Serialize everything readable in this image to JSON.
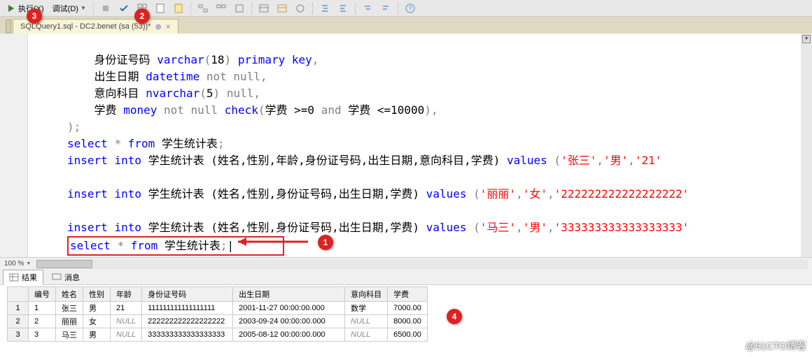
{
  "toolbar": {
    "execute": "执行(X)",
    "debug": "调试(D)"
  },
  "tab": {
    "title": "SQLQuery1.sql - DC2.benet (sa (53))*"
  },
  "code": {
    "line1_col": "身份证号码",
    "line1_type": "varchar",
    "line1_len": "18",
    "line1_pk": "primary key",
    "line2_col": "出生日期",
    "line2_type": "datetime",
    "line2_notnull": "not null",
    "line3_col": "意向科目",
    "line3_type": "nvarchar",
    "line3_len": "5",
    "line3_null": "null",
    "line4_col": "学费",
    "line4_type": "money",
    "line4_notnull": "not null",
    "line4_check": "check",
    "line4_cond_a": "学费 >=0",
    "line4_and": "and",
    "line4_cond_b": "学费 <=10000",
    "closeparen": ");",
    "sel": "select",
    "star": "*",
    "from": "from",
    "tbl": "学生统计表",
    "ins": "insert",
    "into": "into",
    "cols_full": "(姓名,性别,年龄,身份证号码,出生日期,意向科目,学费)",
    "cols_part": "(姓名,性别,身份证号码,出生日期,学费)",
    "values": "values",
    "v1_a": "'张三'",
    "v1_b": "'男'",
    "v1_c": "'21'",
    "v2_a": "'丽丽'",
    "v2_b": "'女'",
    "v2_c": "'222222222222222222'",
    "v3_a": "'马三'",
    "v3_b": "'男'",
    "v3_c": "'333333333333333333'",
    "cursor": "|"
  },
  "zoom": "100 %",
  "results_tabs": {
    "results": "结果",
    "messages": "消息"
  },
  "grid": {
    "headers": [
      "",
      "编号",
      "姓名",
      "性别",
      "年龄",
      "身份证号码",
      "出生日期",
      "意向科目",
      "学费"
    ],
    "rows": [
      {
        "n": "1",
        "id": "1",
        "name": "张三",
        "sex": "男",
        "age": "21",
        "idcard": "111111111111111111",
        "dob": "2001-11-27 00:00:00.000",
        "subj": "数学",
        "fee": "7000.00"
      },
      {
        "n": "2",
        "id": "2",
        "name": "丽丽",
        "sex": "女",
        "age": "NULL",
        "idcard": "222222222222222222",
        "dob": "2003-09-24 00:00:00.000",
        "subj": "NULL",
        "fee": "8000.00"
      },
      {
        "n": "3",
        "id": "3",
        "name": "马三",
        "sex": "男",
        "age": "NULL",
        "idcard": "333333333333333333",
        "dob": "2005-08-12 00:00:00.000",
        "subj": "NULL",
        "fee": "6500.00"
      }
    ]
  },
  "callouts": {
    "c1": "1",
    "c2": "2",
    "c3": "3",
    "c4": "4"
  },
  "watermark": "@51CTO博客"
}
